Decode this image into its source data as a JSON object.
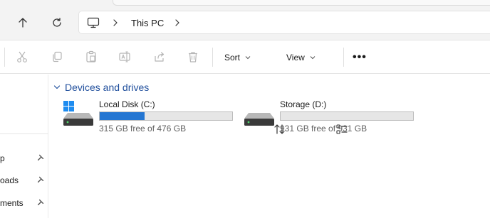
{
  "address_bar": {
    "breadcrumb": "This PC"
  },
  "toolbar": {
    "sort_label": "Sort",
    "view_label": "View",
    "more_label": "•••"
  },
  "nav_pane": {
    "items": [
      {
        "label": "Desktop",
        "visible_text": "p",
        "pinned": true
      },
      {
        "label": "Downloads",
        "visible_text": "oads",
        "pinned": true
      },
      {
        "label": "Documents",
        "visible_text": "ments",
        "pinned": true
      }
    ]
  },
  "main": {
    "group_title": "Devices and drives",
    "drives": [
      {
        "name": "Local Disk (C:)",
        "free_text": "315 GB free of 476 GB",
        "used_fraction": 0.338,
        "icon": "windows-drive-icon"
      },
      {
        "name": "Storage (D:)",
        "free_text": "931 GB free of 931 GB",
        "used_fraction": 0.0,
        "icon": "drive-icon"
      }
    ]
  },
  "colors": {
    "accent": "#2576d2",
    "group_title": "#1f4e9c",
    "windows_logo": "#1e8cf0"
  }
}
